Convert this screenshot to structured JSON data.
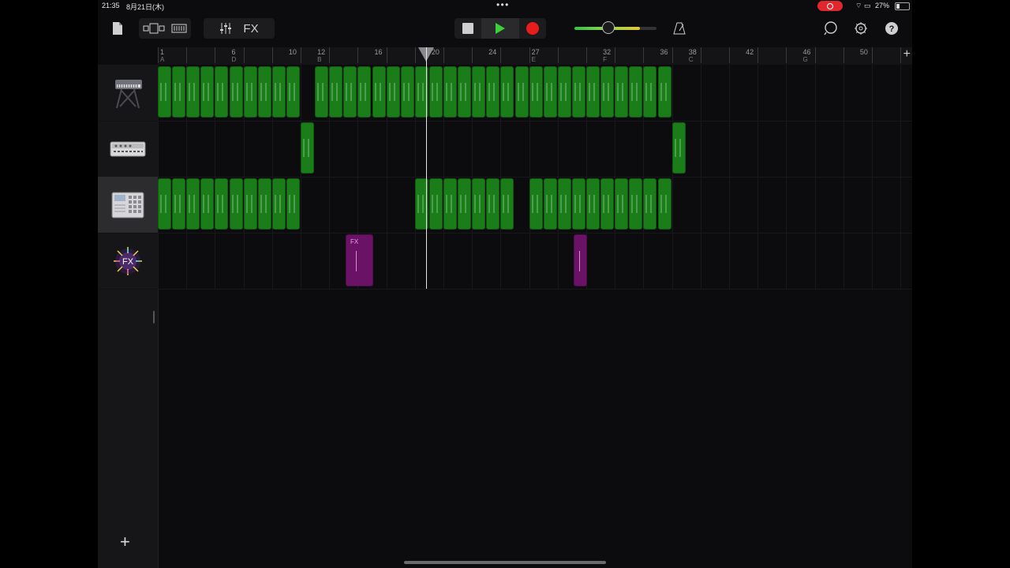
{
  "status": {
    "time": "21:35",
    "date": "8月21日(木)",
    "battery": "27%"
  },
  "toolbar": {
    "fx_label": "FX",
    "volume_level": 0.8,
    "colors": {
      "play": "#3ad13a",
      "record": "#e81c1c",
      "volume_accent": "#35c04a"
    },
    "icons": [
      "document-icon",
      "browser-view-icon",
      "tracks-view-icon",
      "mixer-icon",
      "stop-icon",
      "play-icon",
      "record-icon",
      "metronome-icon",
      "loop-icon",
      "settings-icon",
      "help-icon"
    ]
  },
  "ruler": {
    "bars": [
      {
        "num": "1",
        "section": "A"
      },
      {
        "num": "6",
        "section": "D"
      },
      {
        "num": "10",
        "section": ""
      },
      {
        "num": "12",
        "section": "B"
      },
      {
        "num": "16",
        "section": ""
      },
      {
        "num": "20",
        "section": ""
      },
      {
        "num": "24",
        "section": ""
      },
      {
        "num": "27",
        "section": "E"
      },
      {
        "num": "32",
        "section": "F"
      },
      {
        "num": "36",
        "section": ""
      },
      {
        "num": "38",
        "section": "C"
      },
      {
        "num": "42",
        "section": ""
      },
      {
        "num": "46",
        "section": "G"
      },
      {
        "num": "50",
        "section": ""
      }
    ],
    "add_label": "+"
  },
  "tracks": [
    {
      "name": "keyboard-synth",
      "icon": "keyboard-icon",
      "selected": false
    },
    {
      "name": "drum-machine",
      "icon": "drum-machine-icon",
      "selected": false
    },
    {
      "name": "sampler",
      "icon": "sampler-icon",
      "selected": true
    },
    {
      "name": "fx",
      "icon": "fx-icon",
      "selected": false
    }
  ],
  "fx_region_label": "FX",
  "playhead_bar": 20,
  "add_track_label": "+"
}
